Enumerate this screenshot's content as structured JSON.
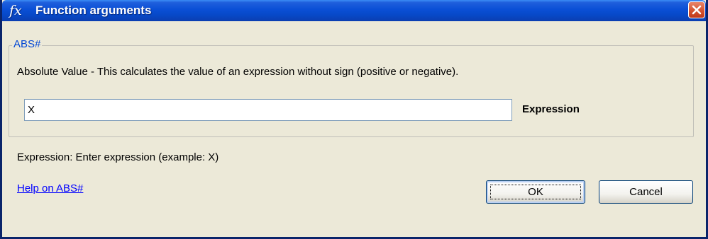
{
  "window": {
    "title": "Function arguments",
    "title_icon": "fx"
  },
  "group": {
    "legend": "ABS#",
    "description": "Absolute Value - This calculates the value of an expression without sign (positive or negative).",
    "expression_value": "X",
    "expression_label": "Expression"
  },
  "hint": "Expression: Enter expression (example: X)",
  "help_link": "Help on  ABS#",
  "buttons": {
    "ok": "OK",
    "cancel": "Cancel"
  },
  "colors": {
    "titlebar": "#0A4FD6",
    "dialog_bg": "#ECE9D8",
    "legend_text": "#0046D5",
    "link": "#0000FF",
    "close_button": "#D24F2C"
  },
  "icons": [
    "fx-icon",
    "close-icon"
  ]
}
